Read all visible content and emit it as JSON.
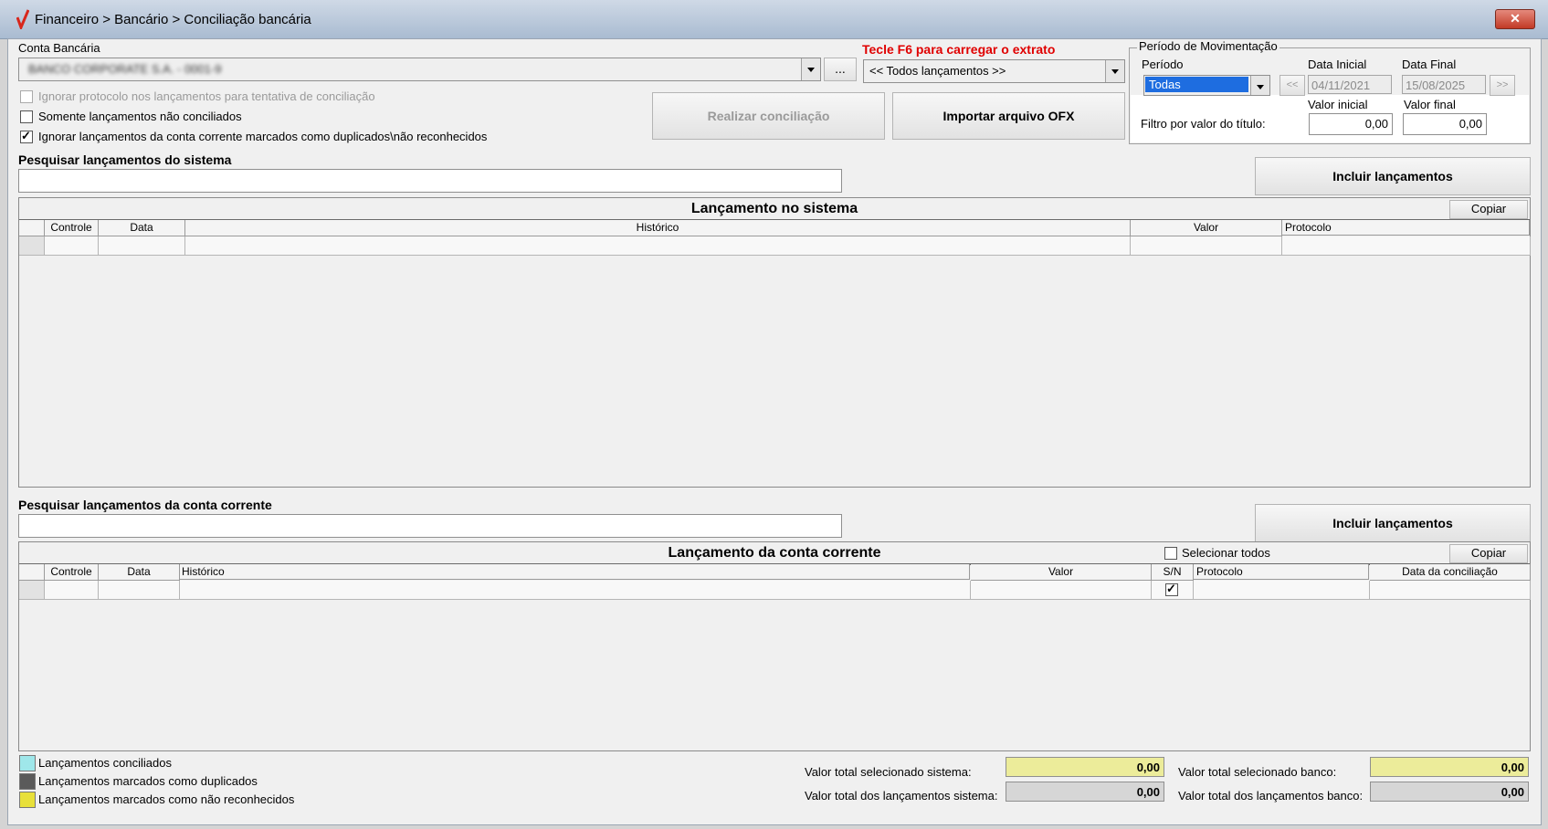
{
  "window": {
    "title": "Financeiro > Bancário > Conciliação bancária",
    "close_label": "✕"
  },
  "colors": {
    "conciliado": "#9fe7ea",
    "duplicado": "#5a5a5a",
    "nao_reconhecido": "#e8e03a",
    "hint_red": "#e00000",
    "selected_blue": "#1e6de0",
    "total_yellow": "#ecec9a",
    "total_gray": "#d6d6d6"
  },
  "conta": {
    "label": "Conta Bancária",
    "value": "BANCO CORPORATE S.A. - 0001-9",
    "browse_label": "..."
  },
  "hint": {
    "text": "Tecle F6 para carregar o extrato"
  },
  "extrato_combo": {
    "value": "<< Todos lançamentos >>"
  },
  "options": {
    "ignorar_protocolo": "Ignorar protocolo nos lançamentos para tentativa de conciliação",
    "somente_nao_conciliados": "Somente lançamentos não conciliados",
    "ignorar_duplicados": "Ignorar lançamentos da conta corrente marcados como duplicados\\não reconhecidos"
  },
  "buttons": {
    "realizar": "Realizar conciliação",
    "importar": "Importar arquivo OFX",
    "incluir": "Incluir lançamentos",
    "copiar": "Copiar"
  },
  "periodo": {
    "group_label": "Período de Movimentação",
    "periodo_label": "Período",
    "periodo_value": "Todas",
    "prev": "<<",
    "next": ">>",
    "data_inicial_label": "Data Inicial",
    "data_inicial": "04/11/2021",
    "data_final_label": "Data Final",
    "data_final": "15/08/2025",
    "valor_inicial_label": "Valor inicial",
    "valor_inicial": "0,00",
    "valor_final_label": "Valor final",
    "valor_final": "0,00",
    "filtro_label": "Filtro por valor do título:"
  },
  "sistema": {
    "search_label": "Pesquisar lançamentos do sistema",
    "grid_title": "Lançamento no sistema",
    "columns": [
      "Controle",
      "Data",
      "Histórico",
      "Valor",
      "Protocolo"
    ]
  },
  "conta_corrente": {
    "search_label": "Pesquisar lançamentos da conta corrente",
    "grid_title": "Lançamento da conta corrente",
    "select_all": "Selecionar todos",
    "columns": [
      "Controle",
      "Data",
      "Histórico",
      "Valor",
      "S/N",
      "Protocolo",
      "Data da conciliação"
    ]
  },
  "legend": [
    "Lançamentos conciliados",
    "Lançamentos marcados como duplicados",
    "Lançamentos marcados como não reconhecidos"
  ],
  "totals": {
    "sel_sistema_label": "Valor total selecionado sistema:",
    "sel_sistema": "0,00",
    "tot_sistema_label": "Valor total dos lançamentos sistema:",
    "tot_sistema": "0,00",
    "sel_banco_label": "Valor total selecionado banco:",
    "sel_banco": "0,00",
    "tot_banco_label": "Valor total dos lançamentos banco:",
    "tot_banco": "0,00"
  }
}
